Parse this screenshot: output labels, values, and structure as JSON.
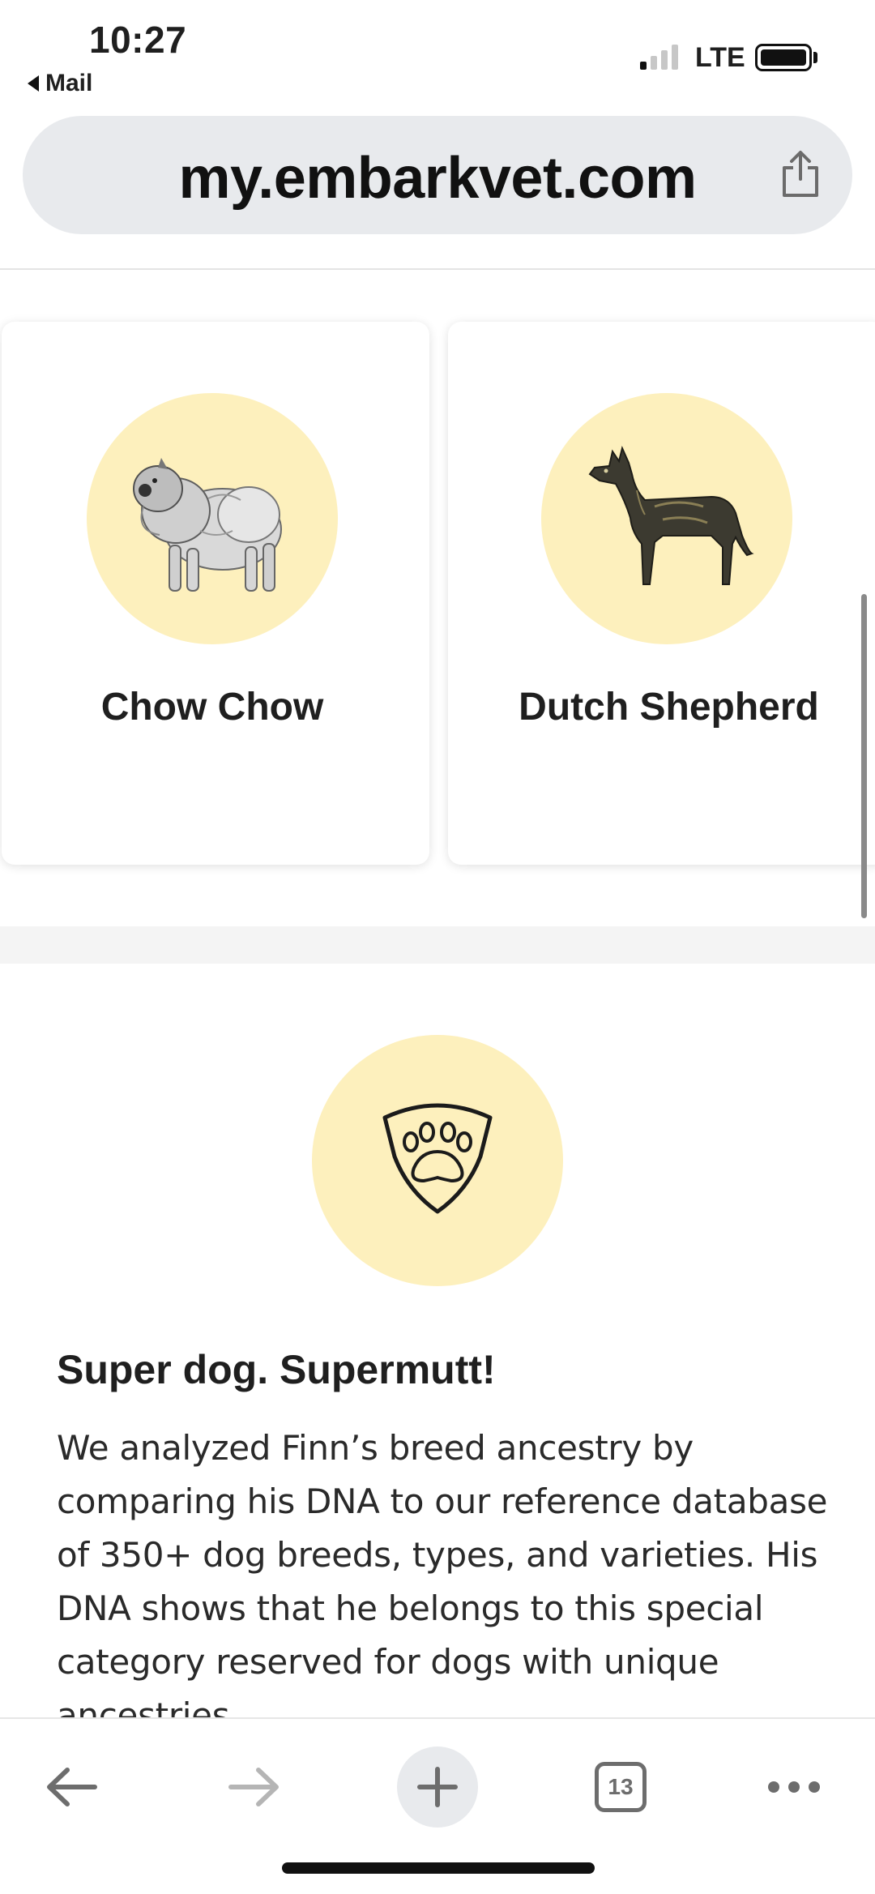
{
  "status_bar": {
    "time": "10:27",
    "back_app": "Mail",
    "network": "LTE",
    "icons": [
      "signal-icon",
      "battery-icon"
    ]
  },
  "browser": {
    "url": "my.embarkvet.com",
    "share_icon": "share-icon"
  },
  "breed_cards": [
    {
      "name": "Chow Chow",
      "image": "chow-chow-illustration"
    },
    {
      "name": "Dutch Shepherd",
      "image": "dutch-shepherd-illustration"
    }
  ],
  "supermutt": {
    "icon": "paw-shield-icon",
    "title": "Super dog. Supermutt!",
    "body": "We analyzed Finn’s breed ancestry by comparing his DNA to our reference database of 350+ dog breeds, types, and varieties. His DNA shows that he belongs to this special category reserved for dogs with unique ancestries."
  },
  "toolbar": {
    "tab_count": "13",
    "icons": [
      "back-arrow-icon",
      "forward-arrow-icon",
      "plus-icon",
      "tabs-icon",
      "more-icon"
    ]
  },
  "colors": {
    "accent_circle": "#fdf0bd",
    "url_bar": "#e8eaed",
    "text": "#1f1f1f"
  }
}
